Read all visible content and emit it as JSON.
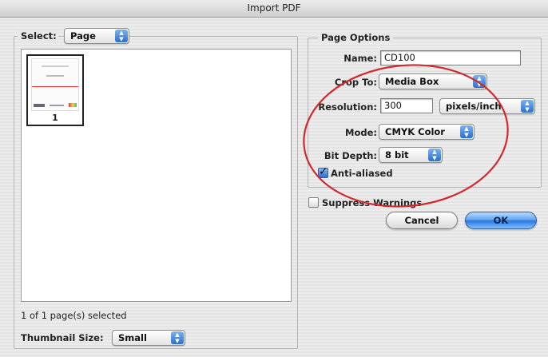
{
  "window": {
    "title": "Import PDF"
  },
  "select": {
    "label": "Select:",
    "value": "Page",
    "thumbnail_page_number": "1",
    "selection_status": "1 of 1 page(s) selected",
    "thumbnail_size_label": "Thumbnail Size:",
    "thumbnail_size_value": "Small"
  },
  "page_options": {
    "legend": "Page Options",
    "name_label": "Name:",
    "name_value": "CD100",
    "crop_label": "Crop To:",
    "crop_value": "Media Box",
    "resolution_label": "Resolution:",
    "resolution_value": "300",
    "resolution_unit": "pixels/inch",
    "mode_label": "Mode:",
    "mode_value": "CMYK Color",
    "bit_depth_label": "Bit Depth:",
    "bit_depth_value": "8 bit",
    "anti_aliased_label": "Anti-aliased",
    "anti_aliased_checked": true
  },
  "suppress_warnings": {
    "label": "Suppress Warnings",
    "checked": false
  },
  "buttons": {
    "cancel": "Cancel",
    "ok": "OK"
  },
  "colors": {
    "annotation_circle": "#d0282c",
    "default_button": "#2a74de"
  }
}
